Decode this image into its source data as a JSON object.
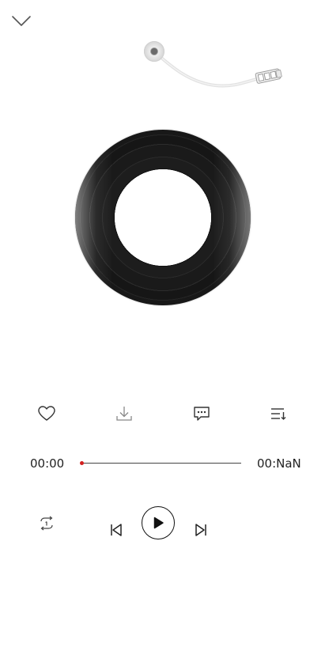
{
  "header": {
    "collapse_icon": "chevron-down-icon"
  },
  "player": {
    "disc_icon": "vinyl-record",
    "tonearm_icon": "tonearm-needle"
  },
  "actions": [
    {
      "name": "like",
      "icon": "heart-icon"
    },
    {
      "name": "download",
      "icon": "download-icon"
    },
    {
      "name": "comments",
      "icon": "comment-icon"
    },
    {
      "name": "playlist",
      "icon": "playlist-icon"
    }
  ],
  "progress": {
    "current_time": "00:00",
    "total_time": "00:NaN",
    "fraction": 0,
    "accent_color": "#d21f1f"
  },
  "controls": {
    "mode_icon": "repeat-one-icon",
    "prev_icon": "skip-previous-icon",
    "play_icon": "play-icon",
    "next_icon": "skip-next-icon"
  }
}
